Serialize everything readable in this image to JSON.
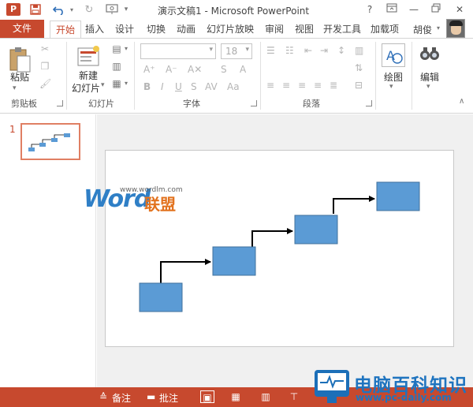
{
  "window": {
    "app_icon": "P",
    "title": "演示文稿1 - Microsoft PowerPoint",
    "help": "?",
    "minimize": "—",
    "close": "✕"
  },
  "qat": {
    "save_icon": "save-icon",
    "undo_icon": "undo-icon",
    "redo_icon": "redo-icon",
    "start_icon": "presentation-icon"
  },
  "tabs": {
    "file": "文件",
    "items": [
      "开始",
      "插入",
      "设计",
      "切换",
      "动画",
      "幻灯片放映",
      "审阅",
      "视图",
      "开发工具",
      "加载项"
    ],
    "active": "开始"
  },
  "user": {
    "name": "胡俊"
  },
  "ribbon": {
    "clipboard": {
      "label": "剪贴板",
      "paste": "粘贴"
    },
    "slides": {
      "label": "幻灯片",
      "new_slide_line1": "新建",
      "new_slide_line2": "幻灯片"
    },
    "font": {
      "label": "字体",
      "font_size": "18"
    },
    "paragraph": {
      "label": "段落"
    },
    "drawing": {
      "label": "绘图"
    },
    "editing": {
      "label": "编辑"
    }
  },
  "thumbnails": {
    "slide_number": "1"
  },
  "watermark": {
    "word": "Word",
    "cn": "联盟",
    "url": "www.wordlm.com"
  },
  "statusbar": {
    "notes": "备注",
    "comments": "批注"
  },
  "badge": {
    "title": "电脑百科知识",
    "url": "www.pc-daily.com"
  },
  "colors": {
    "accent": "#c7492e",
    "shape_fill": "#5b9bd5",
    "shape_stroke": "#41719c"
  }
}
